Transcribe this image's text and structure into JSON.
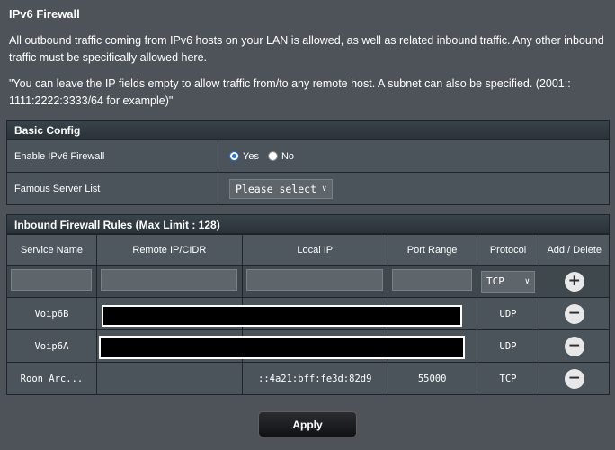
{
  "page": {
    "title": "IPv6 Firewall",
    "description1": "All outbound traffic coming from IPv6 hosts on your LAN is allowed, as well as related inbound traffic. Any other inbound traffic must be specifically allowed here.",
    "description2": "\"You can leave the IP fields empty to allow traffic from/to any remote host. A subnet can also be specified. (2001:: 1111:2222:3333/64 for example)\""
  },
  "basic_config": {
    "header": "Basic Config",
    "enable_label": "Enable IPv6 Firewall",
    "yes_label": "Yes",
    "no_label": "No",
    "enabled": "Yes",
    "famous_label": "Famous Server List",
    "famous_select": "Please select"
  },
  "rules": {
    "header": "Inbound Firewall Rules (Max Limit : 128)",
    "columns": [
      "Service Name",
      "Remote IP/CIDR",
      "Local IP",
      "Port Range",
      "Protocol",
      "Add / Delete"
    ],
    "new_protocol": "TCP",
    "rows": [
      {
        "service": "Voip6B",
        "remote": "",
        "local": "",
        "port": "",
        "protocol": "UDP"
      },
      {
        "service": "Voip6A",
        "remote": "",
        "local": "",
        "port": "",
        "protocol": "UDP"
      },
      {
        "service": "Roon Arc...",
        "remote": "",
        "local": "::4a21:bff:fe3d:82d9",
        "port": "55000",
        "protocol": "TCP"
      }
    ]
  },
  "apply_label": "Apply",
  "icons": {
    "add": "plus-circle-icon",
    "delete": "minus-circle-icon",
    "dropdown": "chevron-down-icon"
  },
  "colors": {
    "background": "#4d5358",
    "header": "#2a3338",
    "radio_accent": "#2a6fd6"
  }
}
